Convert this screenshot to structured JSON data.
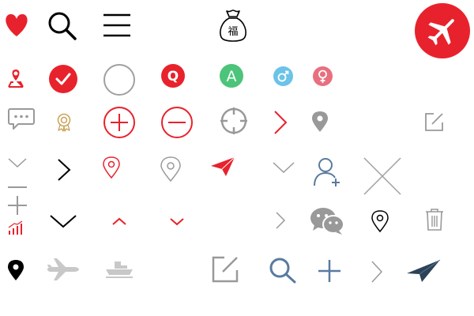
{
  "icons": {
    "bag_char": "福",
    "q_letter": "Q",
    "a_letter": "A"
  },
  "colors": {
    "red": "#e8222c",
    "green": "#4cc47a",
    "blue_male": "#6bc3e8",
    "pink_female": "#e8707e",
    "gray": "#999999",
    "light_gray": "#c8c8c8",
    "gold": "#c9a35a",
    "steel_blue": "#5a7aa0",
    "navy": "#2c4257",
    "black": "#000000"
  }
}
